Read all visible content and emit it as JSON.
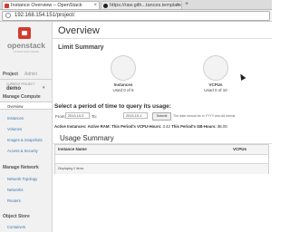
{
  "browser": {
    "tabs": [
      {
        "title": "Instance Overview – OpenStack",
        "active": true
      },
      {
        "title": "https://raw.gith...tances.template",
        "active": false
      }
    ],
    "url": "192.168.154.151/project/"
  },
  "sidebar": {
    "logo": {
      "name": "openstack",
      "tagline": "CLOUD SOFTWARE"
    },
    "tabs": [
      "Project",
      "Admin"
    ],
    "current_project_label": "CURRENT PROJECT",
    "current_project": "demo",
    "sections": [
      {
        "title": "Manage Compute",
        "items": [
          "Overview",
          "Instances",
          "Volumes",
          "Images & Snapshots",
          "Access & Security"
        ]
      },
      {
        "title": "Manage Network",
        "items": [
          "Network Topology",
          "Networks",
          "Routers"
        ]
      },
      {
        "title": "Object Store",
        "items": [
          "Containers"
        ]
      }
    ]
  },
  "main": {
    "title": "Overview",
    "limit_summary": {
      "title": "Limit Summary",
      "charts": [
        {
          "label": "Instances",
          "detail": "Used 0 of 5",
          "used": 0,
          "total": 5
        },
        {
          "label": "VCPUs",
          "detail": "Used 0 of 10",
          "used": 0,
          "total": 10
        }
      ]
    },
    "period": {
      "title": "Select a period of time to query its usage:",
      "from_label": "From:",
      "from_value": "2013-10-0",
      "to_label": "To:",
      "to_value": "2013-10-1",
      "submit_label": "Submit",
      "hint": "The date should be in YYYY-mm-dd format."
    },
    "stats": {
      "active_instances_label": "Active Instances:",
      "active_instances": "",
      "active_ram_label": "Active RAM:",
      "active_ram": "",
      "vcpu_hours_label": "This Period's VCPU-Hours:",
      "vcpu_hours": "3.42",
      "gb_hours_label": "This Period's GB-Hours:",
      "gb_hours": "$6.00"
    },
    "usage_summary": {
      "title": "Usage Summary",
      "columns": [
        "Instance Name",
        "VCPUs"
      ],
      "footer": "Displaying 0 items"
    }
  }
}
